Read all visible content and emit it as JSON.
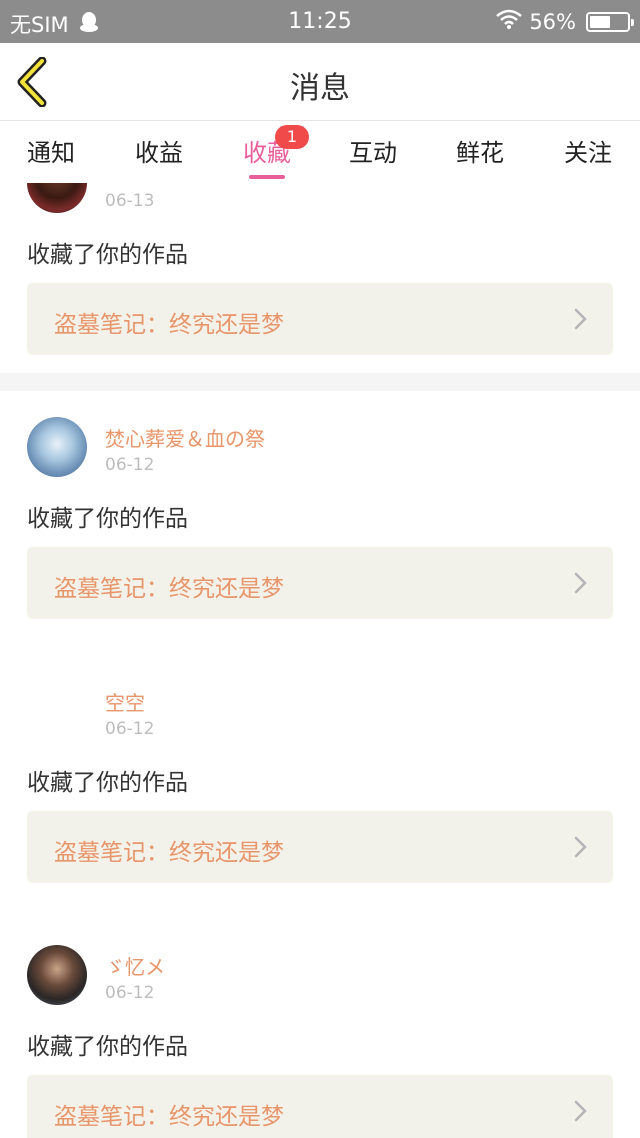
{
  "status_bar": {
    "carrier": "无SIM",
    "time": "11:25",
    "battery": "56%",
    "battery_level": 0.56
  },
  "nav": {
    "title": "消息"
  },
  "tabs": [
    {
      "label": "通知"
    },
    {
      "label": "收益"
    },
    {
      "label": "收藏",
      "badge": "1"
    },
    {
      "label": "互动"
    },
    {
      "label": "鲜花"
    },
    {
      "label": "关注"
    }
  ],
  "feed": [
    {
      "name": "",
      "date": "06-13",
      "action": "收藏了你的作品",
      "work": "盗墓笔记：终究还是梦"
    },
    {
      "name": "焚心葬爱＆血の祭",
      "date": "06-12",
      "action": "收藏了你的作品",
      "work": "盗墓笔记：终究还是梦"
    },
    {
      "name": "空空",
      "date": "06-12",
      "action": "收藏了你的作品",
      "work": "盗墓笔记：终究还是梦"
    },
    {
      "name": "ゞ忆メ",
      "date": "06-12",
      "action": "收藏了你的作品",
      "work": "盗墓笔记：终究还是梦"
    }
  ],
  "colors": {
    "accent": "#e85f9b",
    "name": "#e8956a",
    "badge": "#f04a4a",
    "status_bar": "#8c8c8c"
  }
}
